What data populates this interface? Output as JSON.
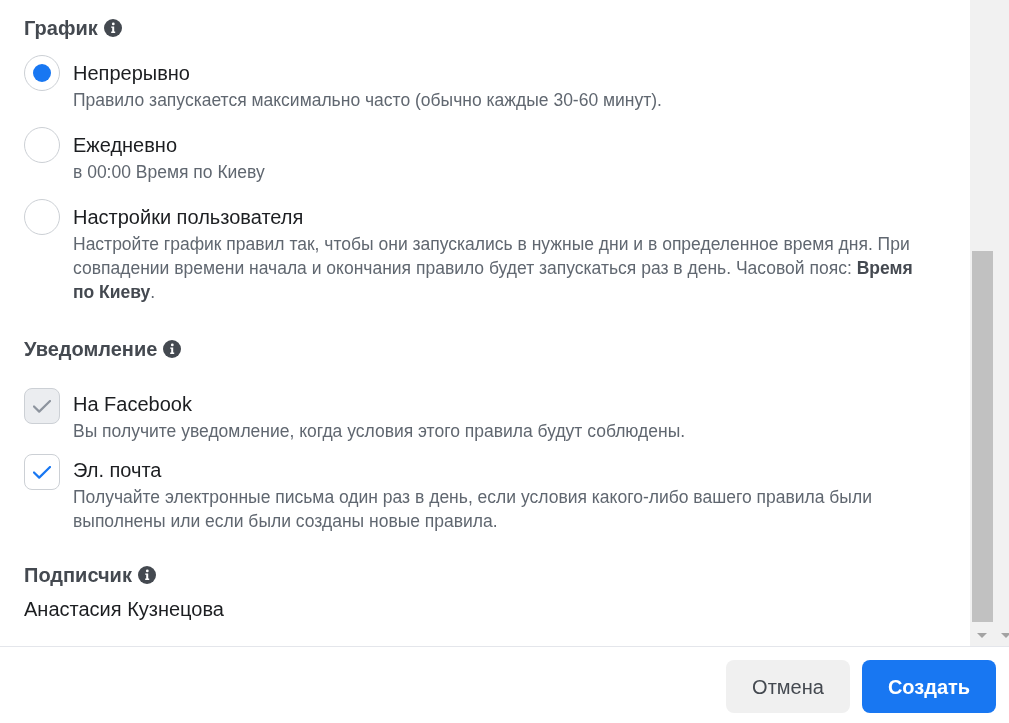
{
  "schedule": {
    "heading": "График",
    "options": [
      {
        "label": "Непрерывно",
        "description": "Правило запускается максимально часто (обычно каждые 30-60 минут).",
        "selected": true
      },
      {
        "label": "Ежедневно",
        "description": "в 00:00 Время по Киеву",
        "selected": false
      },
      {
        "label": "Настройки пользователя",
        "description": "Настройте график правил так, чтобы они запускались в нужные дни и в определенное время дня. При совпадении времени начала и окончания правило будет запускаться раз в день. Часовой пояс: **Время по Киеву**.",
        "selected": false
      }
    ]
  },
  "notification": {
    "heading": "Уведомление",
    "options": [
      {
        "label": "На Facebook",
        "description": "Вы получите уведомление, когда условия этого правила будут соблюдены.",
        "checked": true,
        "disabled": true
      },
      {
        "label": "Эл. почта",
        "description": "Получайте электронные письма один раз в день, если условия какого-либо вашего правила были выполнены или если были созданы новые правила.",
        "checked": true,
        "disabled": false
      }
    ]
  },
  "subscriber": {
    "heading": "Подписчик",
    "name": "Анастасия Кузнецова"
  },
  "buttons": [
    {
      "label": "Отмена",
      "kind": "secondary"
    },
    {
      "label": "Создать",
      "kind": "primary"
    }
  ]
}
